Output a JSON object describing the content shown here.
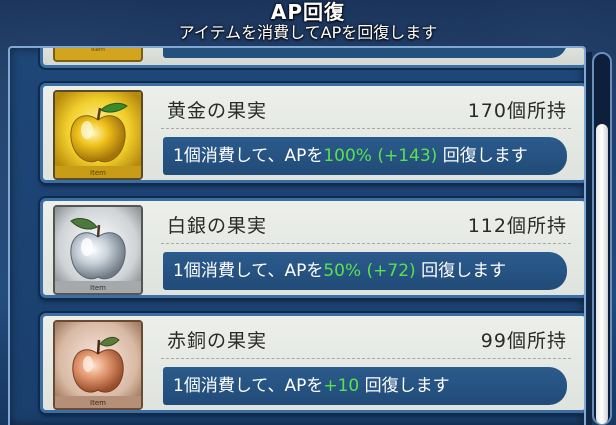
{
  "header": {
    "title": "AP回復",
    "subtitle": "アイテムを消費してAPを回復します"
  },
  "items": [
    {
      "name": "黄金の果実",
      "count": "170",
      "count_suffix": "個所持",
      "desc_prefix": "1個消費して、APを",
      "desc_highlight": "100% (+143)",
      "desc_suffix": " 回復します",
      "thumb_label": "Item",
      "icon": "golden-apple-icon"
    },
    {
      "name": "白銀の果実",
      "count": "112",
      "count_suffix": "個所持",
      "desc_prefix": "1個消費して、APを",
      "desc_highlight": "50% (+72)",
      "desc_suffix": " 回復します",
      "thumb_label": "Item",
      "icon": "silver-apple-icon"
    },
    {
      "name": "赤銅の果実",
      "count": "99",
      "count_suffix": "個所持",
      "desc_prefix": "1個消費して、APを",
      "desc_highlight": "+10",
      "desc_suffix": " 回復します",
      "thumb_label": "Item",
      "icon": "bronze-apple-icon"
    }
  ],
  "previous_item_stub": {
    "thumb_label": "Item"
  },
  "colors": {
    "highlight": "#58e24e",
    "card_border": "#3c6ea3",
    "desc_bar": "#2b5b8c"
  }
}
